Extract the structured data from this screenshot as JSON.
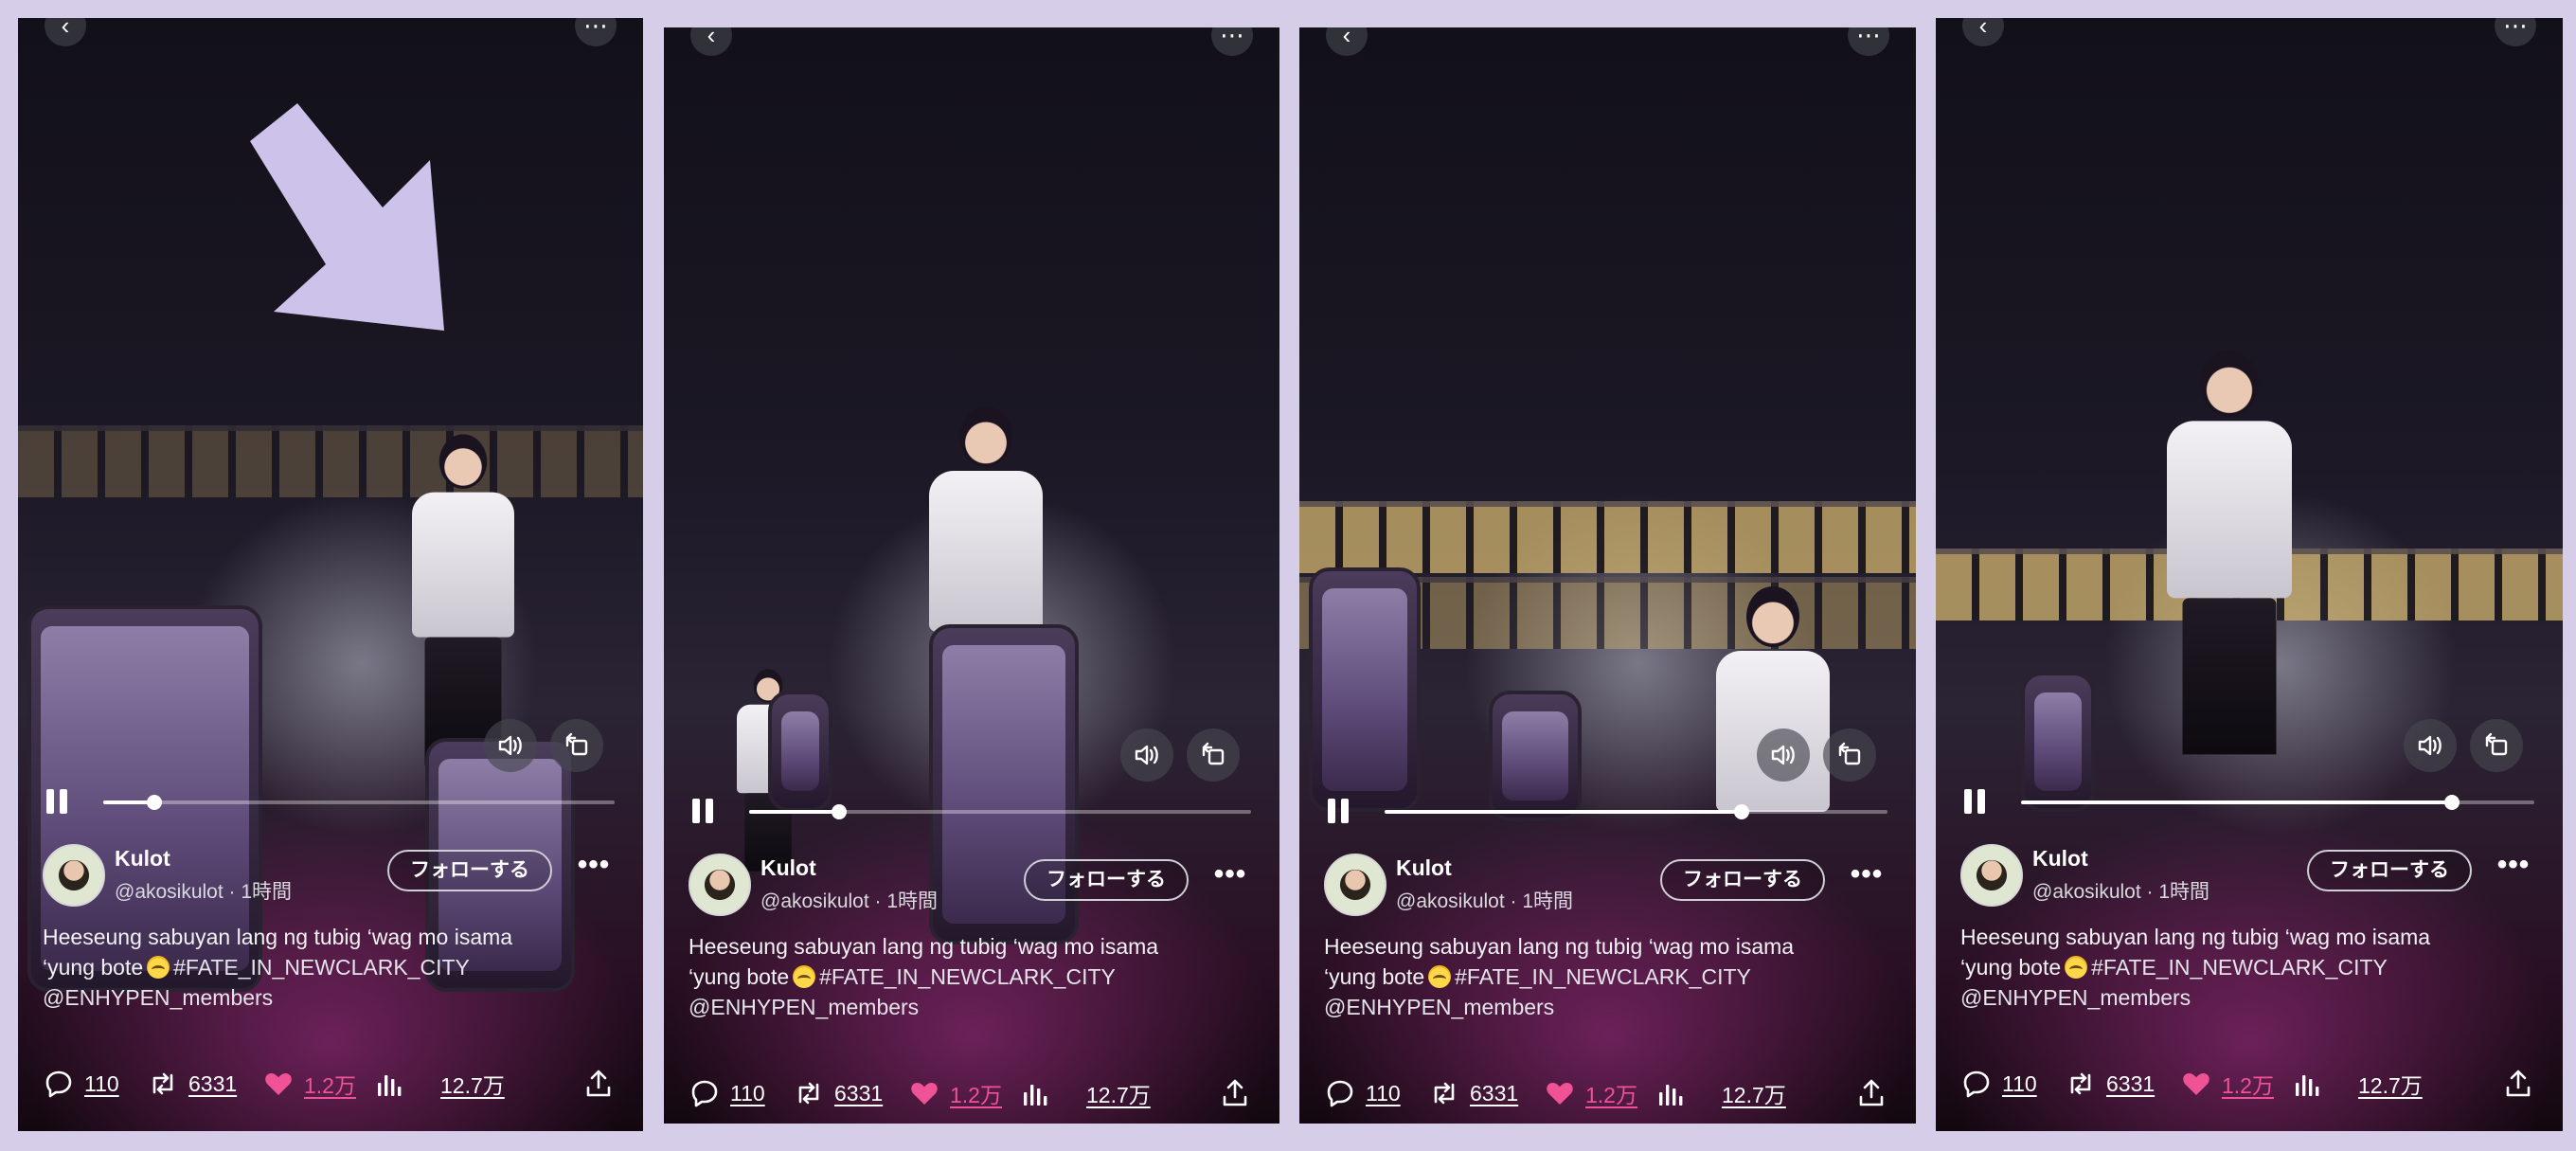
{
  "colors": {
    "background": "#d6cde9",
    "arrow": "#cdc3ea",
    "like_pink": "#f05296",
    "text_white": "#ffffff"
  },
  "icons": [
    "back-icon",
    "more-icon",
    "volume-icon",
    "rotate-icon",
    "pause-icon",
    "comment-icon",
    "repost-icon",
    "heart-icon",
    "views-icon",
    "share-icon"
  ],
  "post": {
    "user_name": "Kulot",
    "user_handle": "@akosikulot · 1時間",
    "follow_label": "フォローする",
    "more_label": "•••",
    "caption_line1": "Heeseung sabuyan lang ng tubig ‘wag mo isama",
    "caption_line2_pre": "‘yung bote",
    "caption_line2_tag": "#FATE_IN_NEWCLARK_CITY",
    "caption_line3": "@ENHYPEN_members",
    "comments": "110",
    "reposts": "6331",
    "likes": "1.2万",
    "views": "12.7万"
  },
  "panels": [
    {
      "progress": 0.1
    },
    {
      "progress": 0.18
    },
    {
      "progress": 0.71
    },
    {
      "progress": 0.84
    }
  ]
}
